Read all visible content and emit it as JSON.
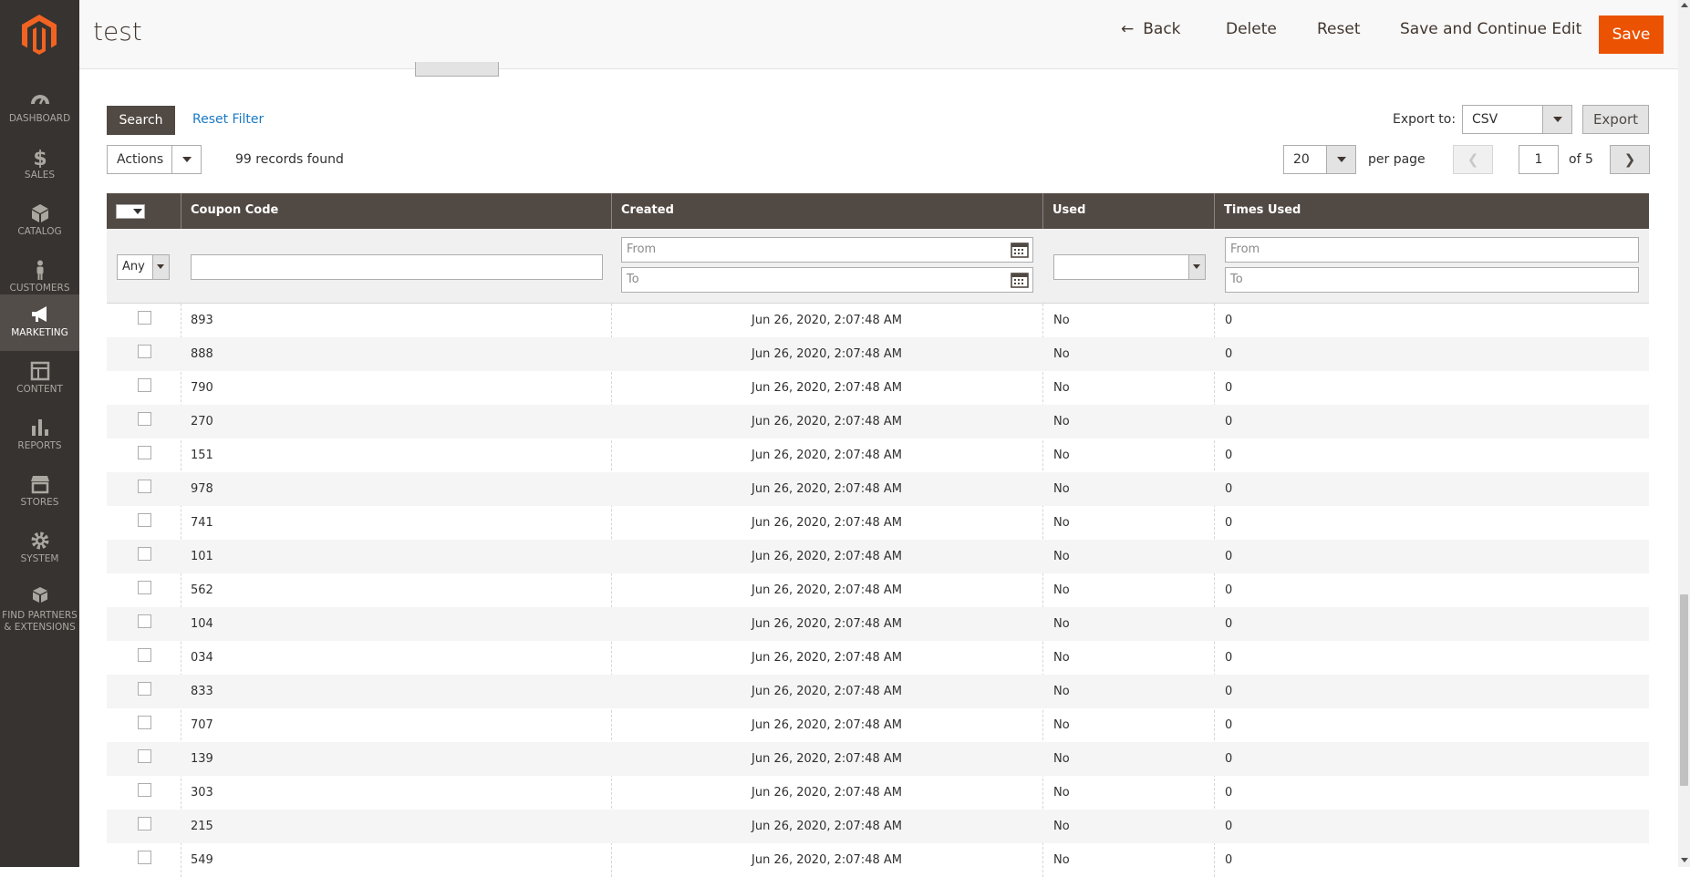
{
  "sidebar": {
    "items": [
      {
        "label": "DASHBOARD",
        "icon": "dashboard-icon"
      },
      {
        "label": "SALES",
        "icon": "dollar-icon"
      },
      {
        "label": "CATALOG",
        "icon": "box-icon"
      },
      {
        "label": "CUSTOMERS",
        "icon": "person-icon"
      },
      {
        "label": "MARKETING",
        "icon": "megaphone-icon"
      },
      {
        "label": "CONTENT",
        "icon": "layout-icon"
      },
      {
        "label": "REPORTS",
        "icon": "bar-chart-icon"
      },
      {
        "label": "STORES",
        "icon": "storefront-icon"
      },
      {
        "label": "SYSTEM",
        "icon": "gear-icon"
      },
      {
        "label": "FIND PARTNERS",
        "label2": "& EXTENSIONS",
        "icon": "cubes-icon"
      }
    ]
  },
  "header": {
    "title": "test",
    "back": "Back",
    "delete": "Delete",
    "reset": "Reset",
    "save_continue": "Save and Continue Edit",
    "save": "Save"
  },
  "toolbar": {
    "search": "Search",
    "reset_filter": "Reset Filter",
    "export_label": "Export to:",
    "export_format": "CSV",
    "export_button": "Export",
    "actions": "Actions",
    "records_found": "99 records found",
    "per_page_value": "20",
    "per_page_label": "per page",
    "current_page": "1",
    "total_pages": "of 5"
  },
  "grid": {
    "columns": [
      "Coupon Code",
      "Created",
      "Used",
      "Times Used"
    ],
    "filters": {
      "select_any": "Any",
      "from": "From",
      "to": "To"
    },
    "rows": [
      {
        "code": "893",
        "created": "Jun 26, 2020, 2:07:48 AM",
        "used": "No",
        "times": "0"
      },
      {
        "code": "888",
        "created": "Jun 26, 2020, 2:07:48 AM",
        "used": "No",
        "times": "0"
      },
      {
        "code": "790",
        "created": "Jun 26, 2020, 2:07:48 AM",
        "used": "No",
        "times": "0"
      },
      {
        "code": "270",
        "created": "Jun 26, 2020, 2:07:48 AM",
        "used": "No",
        "times": "0"
      },
      {
        "code": "151",
        "created": "Jun 26, 2020, 2:07:48 AM",
        "used": "No",
        "times": "0"
      },
      {
        "code": "978",
        "created": "Jun 26, 2020, 2:07:48 AM",
        "used": "No",
        "times": "0"
      },
      {
        "code": "741",
        "created": "Jun 26, 2020, 2:07:48 AM",
        "used": "No",
        "times": "0"
      },
      {
        "code": "101",
        "created": "Jun 26, 2020, 2:07:48 AM",
        "used": "No",
        "times": "0"
      },
      {
        "code": "562",
        "created": "Jun 26, 2020, 2:07:48 AM",
        "used": "No",
        "times": "0"
      },
      {
        "code": "104",
        "created": "Jun 26, 2020, 2:07:48 AM",
        "used": "No",
        "times": "0"
      },
      {
        "code": "034",
        "created": "Jun 26, 2020, 2:07:48 AM",
        "used": "No",
        "times": "0"
      },
      {
        "code": "833",
        "created": "Jun 26, 2020, 2:07:48 AM",
        "used": "No",
        "times": "0"
      },
      {
        "code": "707",
        "created": "Jun 26, 2020, 2:07:48 AM",
        "used": "No",
        "times": "0"
      },
      {
        "code": "139",
        "created": "Jun 26, 2020, 2:07:48 AM",
        "used": "No",
        "times": "0"
      },
      {
        "code": "303",
        "created": "Jun 26, 2020, 2:07:48 AM",
        "used": "No",
        "times": "0"
      },
      {
        "code": "215",
        "created": "Jun 26, 2020, 2:07:48 AM",
        "used": "No",
        "times": "0"
      },
      {
        "code": "549",
        "created": "Jun 26, 2020, 2:07:48 AM",
        "used": "No",
        "times": "0"
      }
    ]
  },
  "colors": {
    "sidebar_bg": "#373330",
    "accent": "#eb5202",
    "grid_header": "#514943",
    "link": "#1979c3"
  }
}
